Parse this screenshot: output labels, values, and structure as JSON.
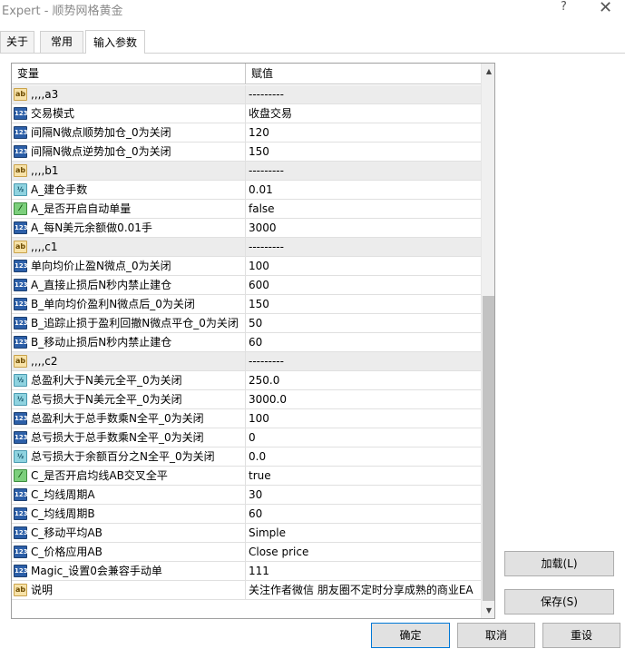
{
  "window": {
    "title": "Expert - 顺势网格黄金",
    "help": "?",
    "close": "✕"
  },
  "tabs": [
    {
      "label": "关于"
    },
    {
      "label": "常用"
    },
    {
      "label": "输入参数"
    }
  ],
  "grid": {
    "col_variable": "变量",
    "col_value": "赋值",
    "rows": [
      {
        "icon": "ab",
        "name": ",,,,a3",
        "value": "---------",
        "group": true
      },
      {
        "icon": "int",
        "name": "交易模式",
        "value": "收盘交易"
      },
      {
        "icon": "int",
        "name": "间隔N微点顺势加仓_0为关闭",
        "value": "120"
      },
      {
        "icon": "int",
        "name": "间隔N微点逆势加仓_0为关闭",
        "value": "150"
      },
      {
        "icon": "ab",
        "name": ",,,,b1",
        "value": "---------",
        "group": true
      },
      {
        "icon": "dbl",
        "name": "A_建仓手数",
        "value": "0.01"
      },
      {
        "icon": "bool",
        "name": "A_是否开启自动单量",
        "value": "false"
      },
      {
        "icon": "int",
        "name": "A_每N美元余额做0.01手",
        "value": "3000"
      },
      {
        "icon": "ab",
        "name": ",,,,c1",
        "value": "---------",
        "group": true
      },
      {
        "icon": "int",
        "name": "单向均价止盈N微点_0为关闭",
        "value": "100"
      },
      {
        "icon": "int",
        "name": "A_直接止损后N秒内禁止建仓",
        "value": "600"
      },
      {
        "icon": "int",
        "name": "B_单向均价盈利N微点后_0为关闭",
        "value": "150"
      },
      {
        "icon": "int",
        "name": "B_追踪止损于盈利回撤N微点平仓_0为关闭",
        "value": "50"
      },
      {
        "icon": "int",
        "name": "B_移动止损后N秒内禁止建仓",
        "value": "60"
      },
      {
        "icon": "ab",
        "name": ",,,,c2",
        "value": "---------",
        "group": true
      },
      {
        "icon": "dbl",
        "name": "总盈利大于N美元全平_0为关闭",
        "value": "250.0"
      },
      {
        "icon": "dbl",
        "name": "总亏损大于N美元全平_0为关闭",
        "value": "3000.0"
      },
      {
        "icon": "int",
        "name": "总盈利大于总手数乘N全平_0为关闭",
        "value": "100"
      },
      {
        "icon": "int",
        "name": "总亏损大于总手数乘N全平_0为关闭",
        "value": "0"
      },
      {
        "icon": "dbl",
        "name": "总亏损大于余额百分之N全平_0为关闭",
        "value": "0.0"
      },
      {
        "icon": "bool",
        "name": "C_是否开启均线AB交叉全平",
        "value": "true"
      },
      {
        "icon": "int",
        "name": "C_均线周期A",
        "value": "30"
      },
      {
        "icon": "int",
        "name": "C_均线周期B",
        "value": "60"
      },
      {
        "icon": "int",
        "name": "C_移动平均AB",
        "value": "Simple"
      },
      {
        "icon": "int",
        "name": "C_价格应用AB",
        "value": "Close price"
      },
      {
        "icon": "int",
        "name": "Magic_设置0会兼容手动单",
        "value": "111"
      },
      {
        "icon": "ab",
        "name": "说明",
        "value": "关注作者微信 朋友圈不定时分享成熟的商业EA"
      }
    ]
  },
  "icon_glyphs": {
    "ab": "ab",
    "int": "123",
    "dbl": "½",
    "bool": "⁄"
  },
  "buttons": {
    "load": "加载(L)",
    "save": "保存(S)",
    "ok": "确定",
    "cancel": "取消",
    "reset": "重设"
  },
  "scrollbar": {
    "up": "▲",
    "down": "▼"
  }
}
